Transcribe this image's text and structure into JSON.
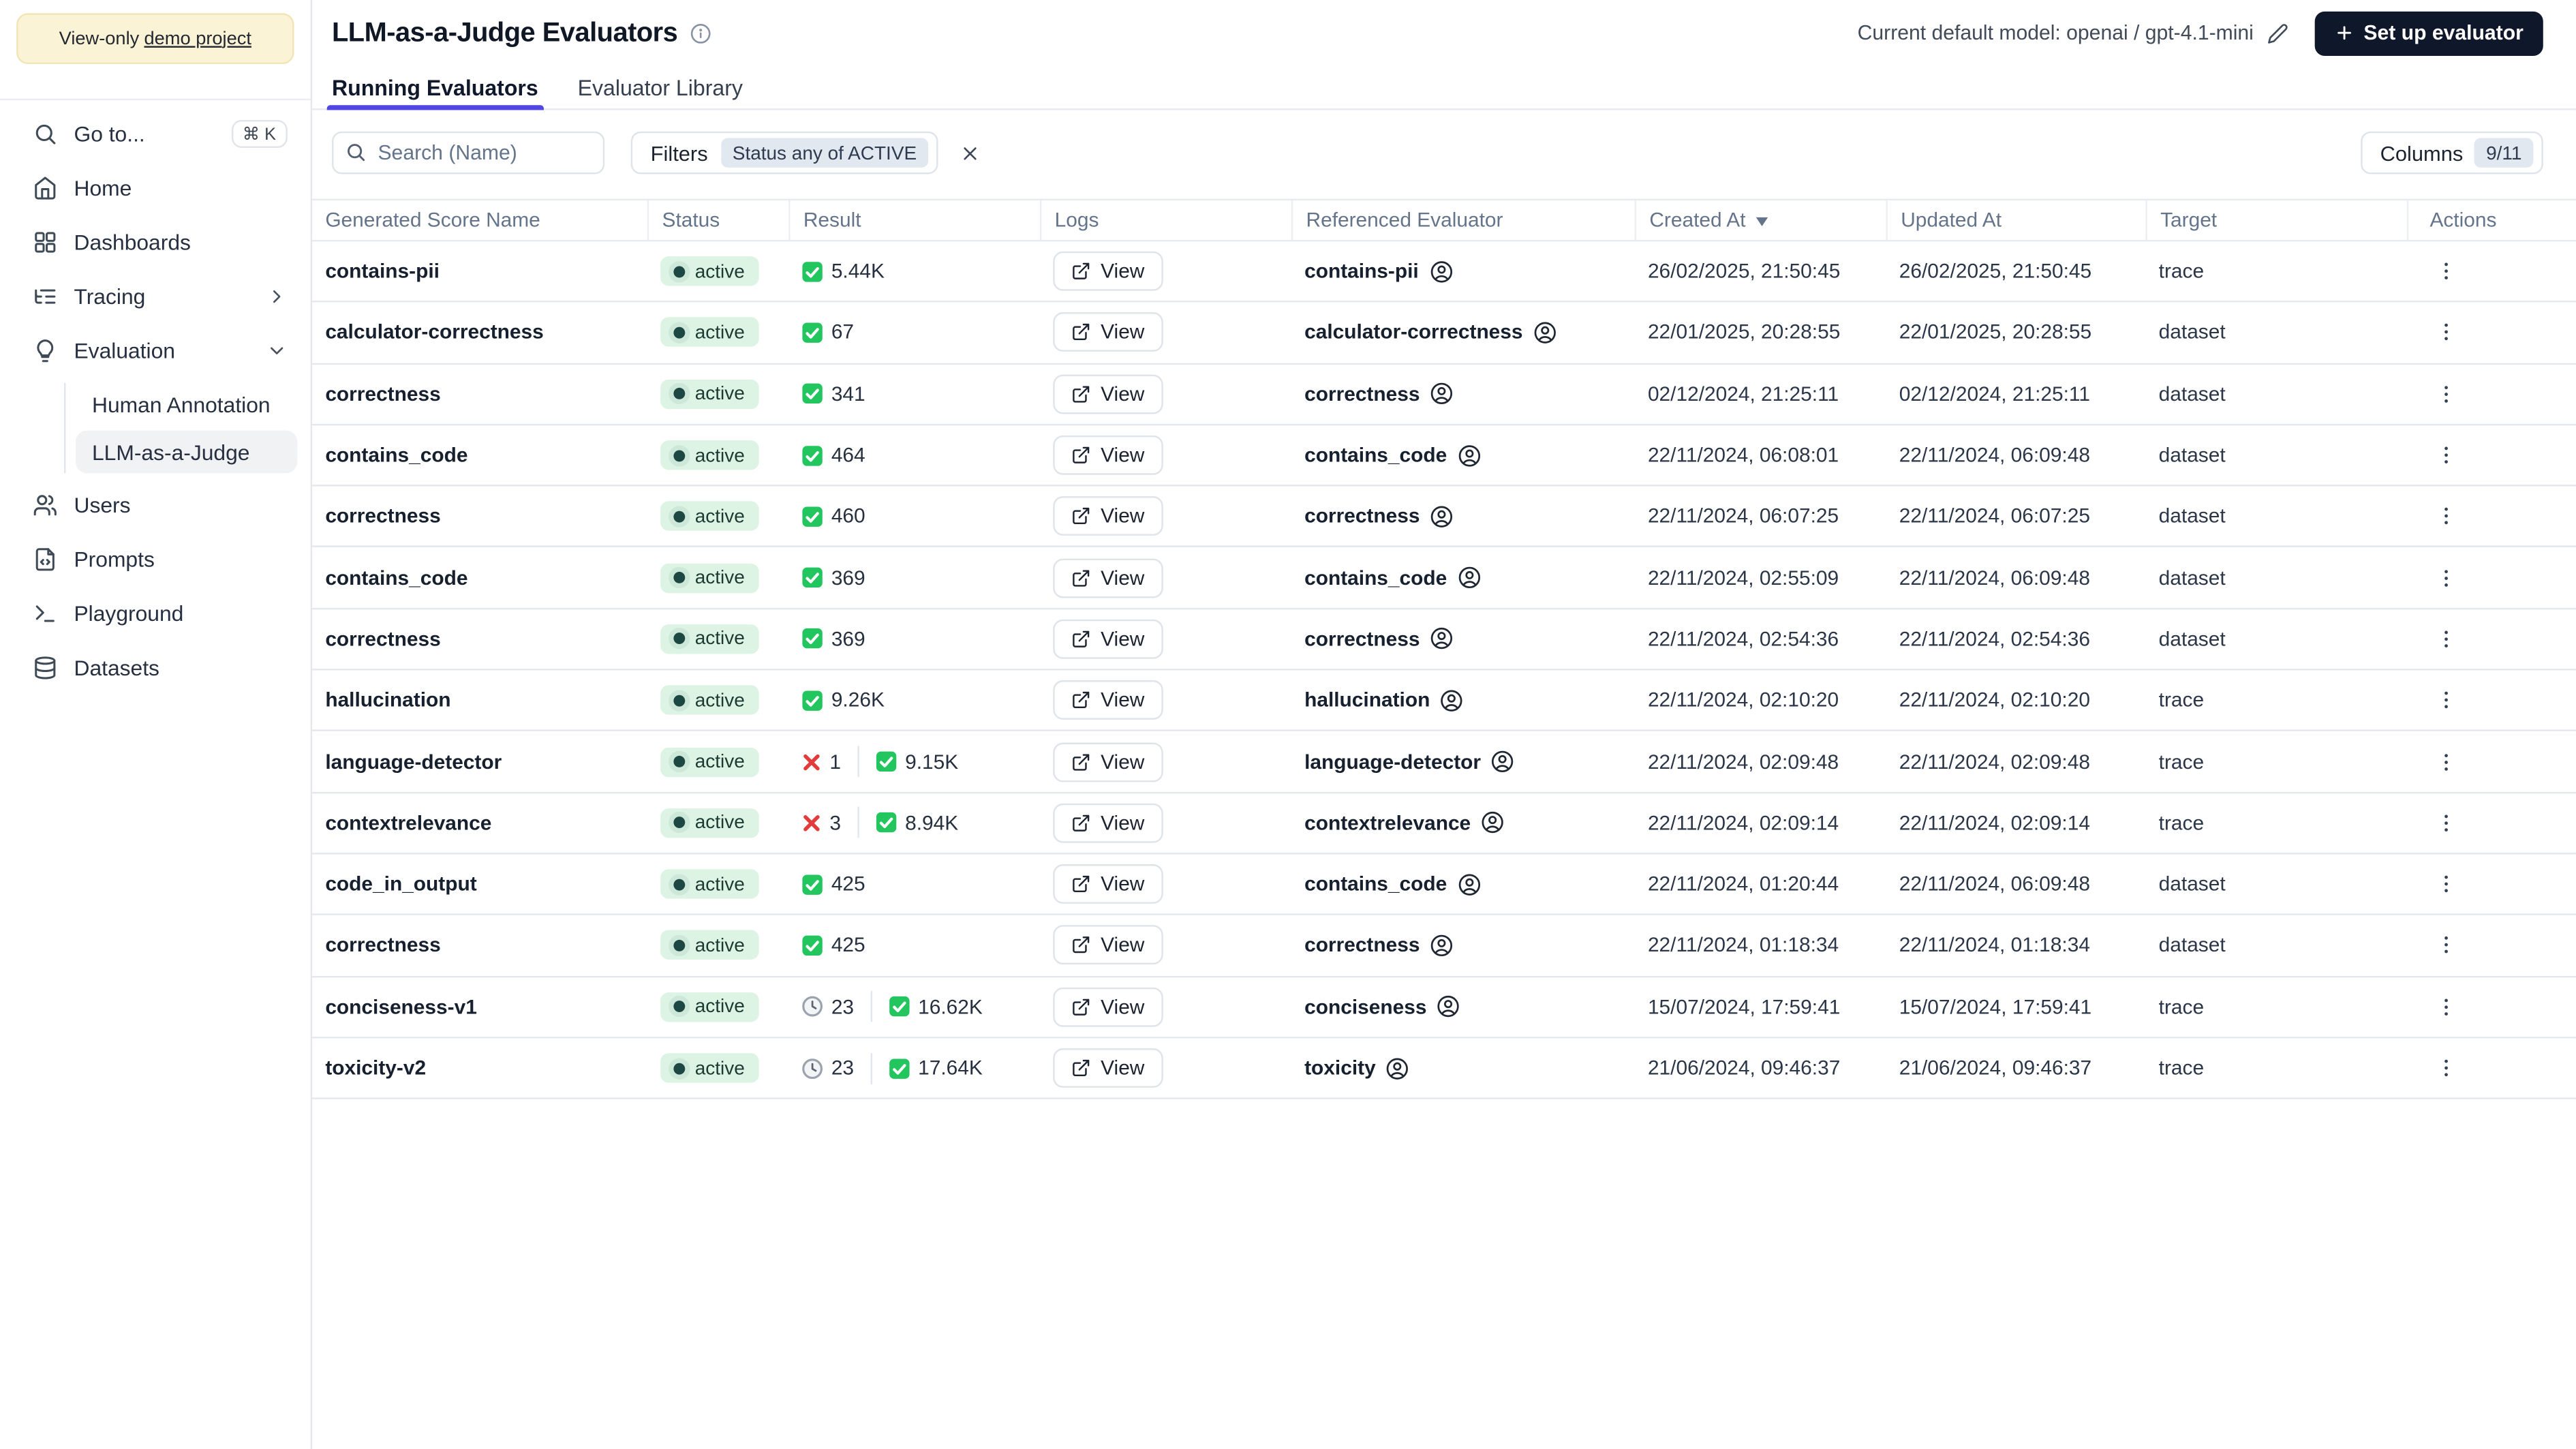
{
  "banner": {
    "prefix": "View-only",
    "link": "demo project"
  },
  "sidebar": {
    "items": [
      {
        "label": "Go to...",
        "shortcut": "⌘ K"
      },
      {
        "label": "Home"
      },
      {
        "label": "Dashboards"
      },
      {
        "label": "Tracing"
      },
      {
        "label": "Evaluation"
      },
      {
        "label": "Human Annotation"
      },
      {
        "label": "LLM-as-a-Judge"
      },
      {
        "label": "Users"
      },
      {
        "label": "Prompts"
      },
      {
        "label": "Playground"
      },
      {
        "label": "Datasets"
      }
    ]
  },
  "header": {
    "title": "LLM-as-a-Judge Evaluators",
    "model_label": "Current default model: openai / gpt-4.1-mini",
    "setup_button": "Set up evaluator"
  },
  "tabs": [
    {
      "label": "Running Evaluators"
    },
    {
      "label": "Evaluator Library"
    }
  ],
  "toolbar": {
    "search_placeholder": "Search (Name)",
    "filters_label": "Filters",
    "filter_chip": "Status any of ACTIVE",
    "columns_label": "Columns",
    "columns_count": "9/11"
  },
  "table": {
    "columns": [
      "Generated Score Name",
      "Status",
      "Result",
      "Logs",
      "Referenced Evaluator",
      "Created At",
      "Updated At",
      "Target",
      "Actions"
    ],
    "sorted_column": "Created At",
    "sort_direction": "desc",
    "view_label": "View",
    "rows": [
      {
        "name": "contains-pii",
        "status": "active",
        "result": [
          {
            "type": "pass",
            "count": "5.44K"
          }
        ],
        "ref": "contains-pii",
        "created": "26/02/2025, 21:50:45",
        "updated": "26/02/2025, 21:50:45",
        "target": "trace"
      },
      {
        "name": "calculator-correctness",
        "status": "active",
        "result": [
          {
            "type": "pass",
            "count": "67"
          }
        ],
        "ref": "calculator-correctness",
        "created": "22/01/2025, 20:28:55",
        "updated": "22/01/2025, 20:28:55",
        "target": "dataset"
      },
      {
        "name": "correctness",
        "status": "active",
        "result": [
          {
            "type": "pass",
            "count": "341"
          }
        ],
        "ref": "correctness",
        "created": "02/12/2024, 21:25:11",
        "updated": "02/12/2024, 21:25:11",
        "target": "dataset"
      },
      {
        "name": "contains_code",
        "status": "active",
        "result": [
          {
            "type": "pass",
            "count": "464"
          }
        ],
        "ref": "contains_code",
        "created": "22/11/2024, 06:08:01",
        "updated": "22/11/2024, 06:09:48",
        "target": "dataset"
      },
      {
        "name": "correctness",
        "status": "active",
        "result": [
          {
            "type": "pass",
            "count": "460"
          }
        ],
        "ref": "correctness",
        "created": "22/11/2024, 06:07:25",
        "updated": "22/11/2024, 06:07:25",
        "target": "dataset"
      },
      {
        "name": "contains_code",
        "status": "active",
        "result": [
          {
            "type": "pass",
            "count": "369"
          }
        ],
        "ref": "contains_code",
        "created": "22/11/2024, 02:55:09",
        "updated": "22/11/2024, 06:09:48",
        "target": "dataset"
      },
      {
        "name": "correctness",
        "status": "active",
        "result": [
          {
            "type": "pass",
            "count": "369"
          }
        ],
        "ref": "correctness",
        "created": "22/11/2024, 02:54:36",
        "updated": "22/11/2024, 02:54:36",
        "target": "dataset"
      },
      {
        "name": "hallucination",
        "status": "active",
        "result": [
          {
            "type": "pass",
            "count": "9.26K"
          }
        ],
        "ref": "hallucination",
        "created": "22/11/2024, 02:10:20",
        "updated": "22/11/2024, 02:10:20",
        "target": "trace"
      },
      {
        "name": "language-detector",
        "status": "active",
        "result": [
          {
            "type": "fail",
            "count": "1"
          },
          {
            "type": "pass",
            "count": "9.15K"
          }
        ],
        "ref": "language-detector",
        "created": "22/11/2024, 02:09:48",
        "updated": "22/11/2024, 02:09:48",
        "target": "trace"
      },
      {
        "name": "contextrelevance",
        "status": "active",
        "result": [
          {
            "type": "fail",
            "count": "3"
          },
          {
            "type": "pass",
            "count": "8.94K"
          }
        ],
        "ref": "contextrelevance",
        "created": "22/11/2024, 02:09:14",
        "updated": "22/11/2024, 02:09:14",
        "target": "trace"
      },
      {
        "name": "code_in_output",
        "status": "active",
        "result": [
          {
            "type": "pass",
            "count": "425"
          }
        ],
        "ref": "contains_code",
        "created": "22/11/2024, 01:20:44",
        "updated": "22/11/2024, 06:09:48",
        "target": "dataset"
      },
      {
        "name": "correctness",
        "status": "active",
        "result": [
          {
            "type": "pass",
            "count": "425"
          }
        ],
        "ref": "correctness",
        "created": "22/11/2024, 01:18:34",
        "updated": "22/11/2024, 01:18:34",
        "target": "dataset"
      },
      {
        "name": "conciseness-v1",
        "status": "active",
        "result": [
          {
            "type": "pending",
            "count": "23"
          },
          {
            "type": "pass",
            "count": "16.62K"
          }
        ],
        "ref": "conciseness",
        "created": "15/07/2024, 17:59:41",
        "updated": "15/07/2024, 17:59:41",
        "target": "trace"
      },
      {
        "name": "toxicity-v2",
        "status": "active",
        "result": [
          {
            "type": "pending",
            "count": "23"
          },
          {
            "type": "pass",
            "count": "17.64K"
          }
        ],
        "ref": "toxicity",
        "created": "21/06/2024, 09:46:37",
        "updated": "21/06/2024, 09:46:37",
        "target": "trace"
      }
    ]
  },
  "colors": {
    "accent": "#4f46e5",
    "button_bg": "#0f172a",
    "badge_bg": "#ddf4e4",
    "badge_dot": "#1d4742",
    "chip_bg": "#e2e8f0",
    "pass_green": "#22c55e",
    "fail_red": "#e23b3b",
    "banner_bg": "#fbf3d6"
  }
}
